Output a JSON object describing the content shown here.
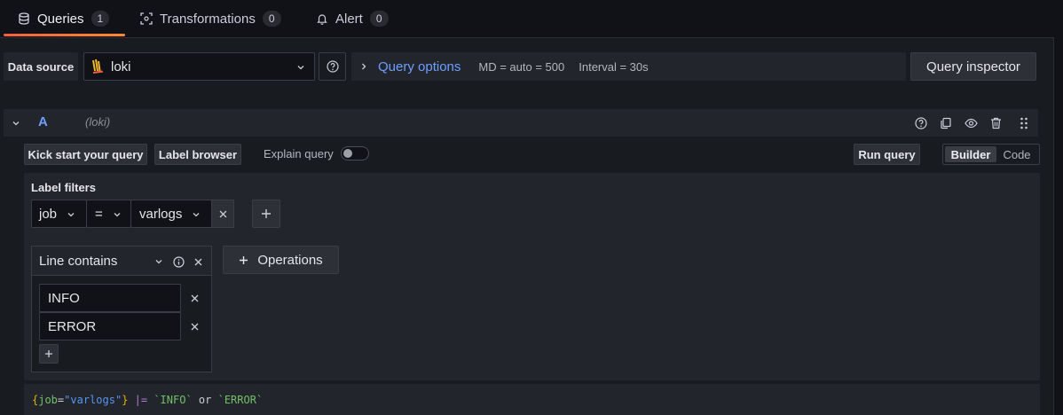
{
  "tabs": [
    {
      "label": "Queries",
      "count": "1",
      "icon": "database-icon"
    },
    {
      "label": "Transformations",
      "count": "0",
      "icon": "transform-icon"
    },
    {
      "label": "Alert",
      "count": "0",
      "icon": "bell-icon"
    }
  ],
  "datasource": {
    "label": "Data source",
    "value": "loki"
  },
  "query_options": {
    "label": "Query options",
    "md": "MD = auto = 500",
    "interval": "Interval = 30s"
  },
  "query_inspector": "Query inspector",
  "query": {
    "ref": "A",
    "ds": "(loki)"
  },
  "toolbar": {
    "kick_start": "Kick start your query",
    "label_browser": "Label browser",
    "explain": "Explain query",
    "run": "Run query",
    "builder": "Builder",
    "code": "Code"
  },
  "label_filters": {
    "title": "Label filters",
    "label": "job",
    "op": "=",
    "value": "varlogs"
  },
  "operation": {
    "name": "Line contains",
    "values": [
      "INFO",
      "ERROR"
    ],
    "add_label": "Operations"
  },
  "preview": {
    "p1": "{",
    "p2": "job",
    "p3": "=",
    "p4": "\"varlogs\"",
    "p5": "}",
    "p6": " |= ",
    "p7": "`INFO`",
    "p8": " or ",
    "p9": "`ERROR`"
  },
  "colors": {
    "accent": "#6e9fff",
    "tab_underline": "#f55f3e"
  }
}
